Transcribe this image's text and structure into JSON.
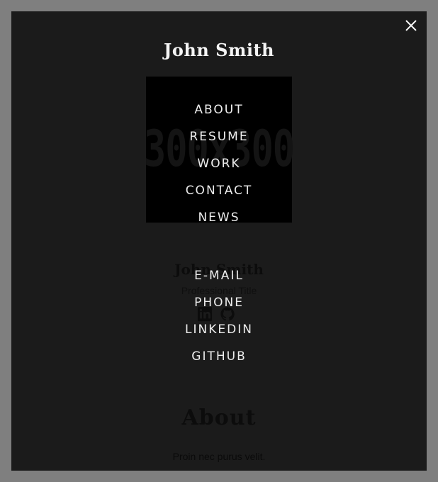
{
  "overlay": {
    "brand": "John Smith",
    "close_icon": "close-icon",
    "nav_items": [
      {
        "label": "ABOUT"
      },
      {
        "label": "RESUME"
      },
      {
        "label": "WORK"
      },
      {
        "label": "CONTACT"
      },
      {
        "label": "NEWS"
      }
    ],
    "contact_items": [
      {
        "label": "E-MAIL"
      },
      {
        "label": "PHONE"
      },
      {
        "label": "LINKEDIN"
      },
      {
        "label": "GITHUB"
      }
    ]
  },
  "background_page": {
    "photo_placeholder": "300x300",
    "name": "John Smith",
    "title": "Professional Title",
    "social_icons": [
      "linkedin-icon",
      "github-icon"
    ],
    "section_heading": "About",
    "paragraph": "Proin nec purus velit."
  },
  "colors": {
    "page_background": "#7f7f7f",
    "overlay_background": "#1b1b1b",
    "menu_text": "#ededed"
  }
}
